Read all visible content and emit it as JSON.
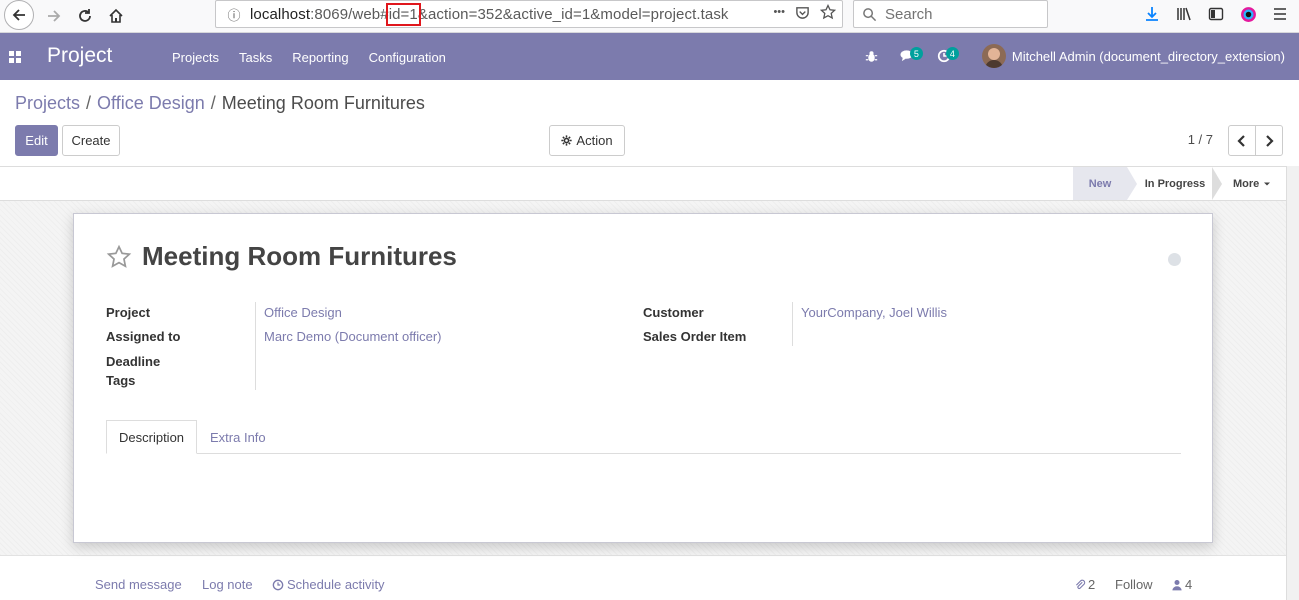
{
  "browser": {
    "url_host": "localhost",
    "url_port_path": ":8069/web#",
    "url_highlight": "id=1",
    "url_rest": "&action=352&active_id=1&model=project.task",
    "search_placeholder": "Search",
    "overflow_dots": "•••"
  },
  "navbar": {
    "app_name": "Project",
    "menu": [
      "Projects",
      "Tasks",
      "Reporting",
      "Configuration"
    ],
    "messages_count": "5",
    "activities_count": "4",
    "user_name": "Mitchell Admin (document_directory_extension)",
    "brand_color": "#7c7bad"
  },
  "breadcrumb": {
    "items": [
      "Projects",
      "Office Design"
    ],
    "current": "Meeting Room Furnitures",
    "separator": "/"
  },
  "buttons": {
    "edit": "Edit",
    "create": "Create",
    "action": "Action"
  },
  "pager": {
    "value": "1 / 7"
  },
  "stages": {
    "new": "New",
    "in_progress": "In Progress",
    "more": "More"
  },
  "record": {
    "title": "Meeting Room Furnitures",
    "fields_left": [
      {
        "label": "Project",
        "value": "Office Design"
      },
      {
        "label": "Assigned to",
        "value": "Marc Demo (Document officer)"
      },
      {
        "label": "Deadline",
        "value": ""
      },
      {
        "label": "Tags",
        "value": ""
      }
    ],
    "fields_right": [
      {
        "label": "Customer",
        "value": "YourCompany, Joel Willis"
      },
      {
        "label": "Sales Order Item",
        "value": ""
      }
    ]
  },
  "tabs": [
    "Description",
    "Extra Info"
  ],
  "chatter": {
    "send_message": "Send message",
    "log_note": "Log note",
    "schedule_activity": "Schedule activity",
    "attachments_count": "2",
    "follow": "Follow",
    "followers_count": "4"
  }
}
